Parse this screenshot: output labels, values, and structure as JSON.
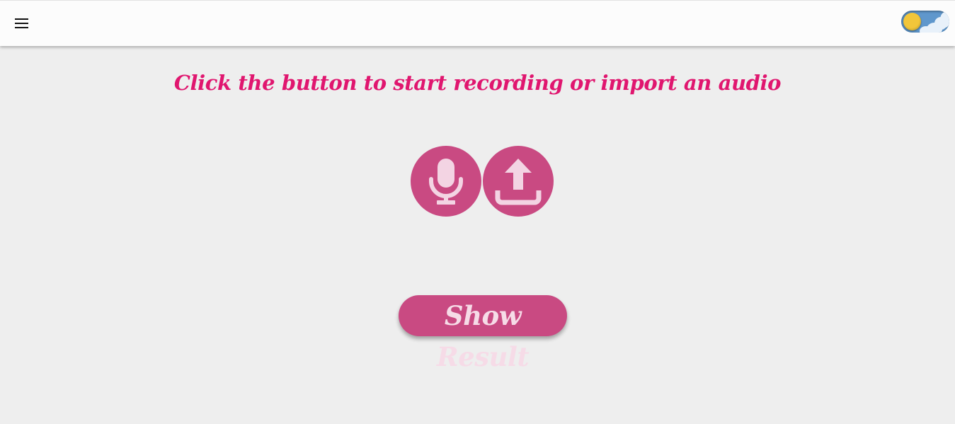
{
  "header": {
    "menu_icon": "hamburger-menu-icon",
    "theme_toggle": {
      "state": "light",
      "icon": "sun-icon",
      "colors": {
        "track": "#5f97cc",
        "sun": "#f2c63a",
        "cloud": "#e8f1fa"
      }
    }
  },
  "main": {
    "heading": "Click the button to start recording or import an audio",
    "record_button_icon": "microphone-icon",
    "upload_button_icon": "upload-icon",
    "result_button_label": "Show Result"
  },
  "colors": {
    "accent": "#e0166f",
    "button": "#c94a82",
    "button_text": "#f6dbe7",
    "background": "#eeeeee",
    "header_bg": "#fcfcfc"
  }
}
